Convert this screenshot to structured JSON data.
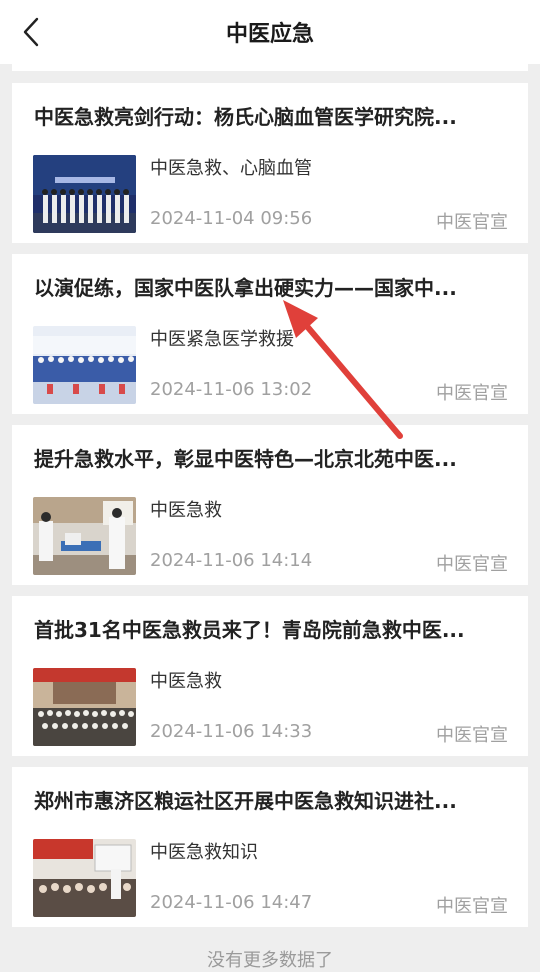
{
  "header": {
    "title": "中医应急",
    "back_icon": "back-chevron-icon"
  },
  "articles": [
    {
      "title": "中医急救亮剑行动：杨氏心脑血管医学研究院...",
      "tags": "中医急救、心脑血管",
      "time": "2024-11-04 09:56",
      "source": "中医官宣"
    },
    {
      "title": "以演促练，国家中医队拿出硬实力——国家中...",
      "tags": "中医紧急医学救援",
      "time": "2024-11-06 13:02",
      "source": "中医官宣"
    },
    {
      "title": "提升急救水平，彰显中医特色—北京北苑中医...",
      "tags": "中医急救",
      "time": "2024-11-06 14:14",
      "source": "中医官宣"
    },
    {
      "title": "首批31名中医急救员来了！青岛院前急救中医...",
      "tags": "中医急救",
      "time": "2024-11-06 14:33",
      "source": "中医官宣"
    },
    {
      "title": "郑州市惠济区粮运社区开展中医急救知识进社...",
      "tags": "中医急救知识",
      "time": "2024-11-06 14:47",
      "source": "中医官宣"
    }
  ],
  "footer": {
    "text": "没有更多数据了"
  },
  "colors": {
    "background": "#eeeeee",
    "card": "#ffffff",
    "muted_text": "#a0a0a0",
    "annotation_arrow": "#e0403a"
  }
}
